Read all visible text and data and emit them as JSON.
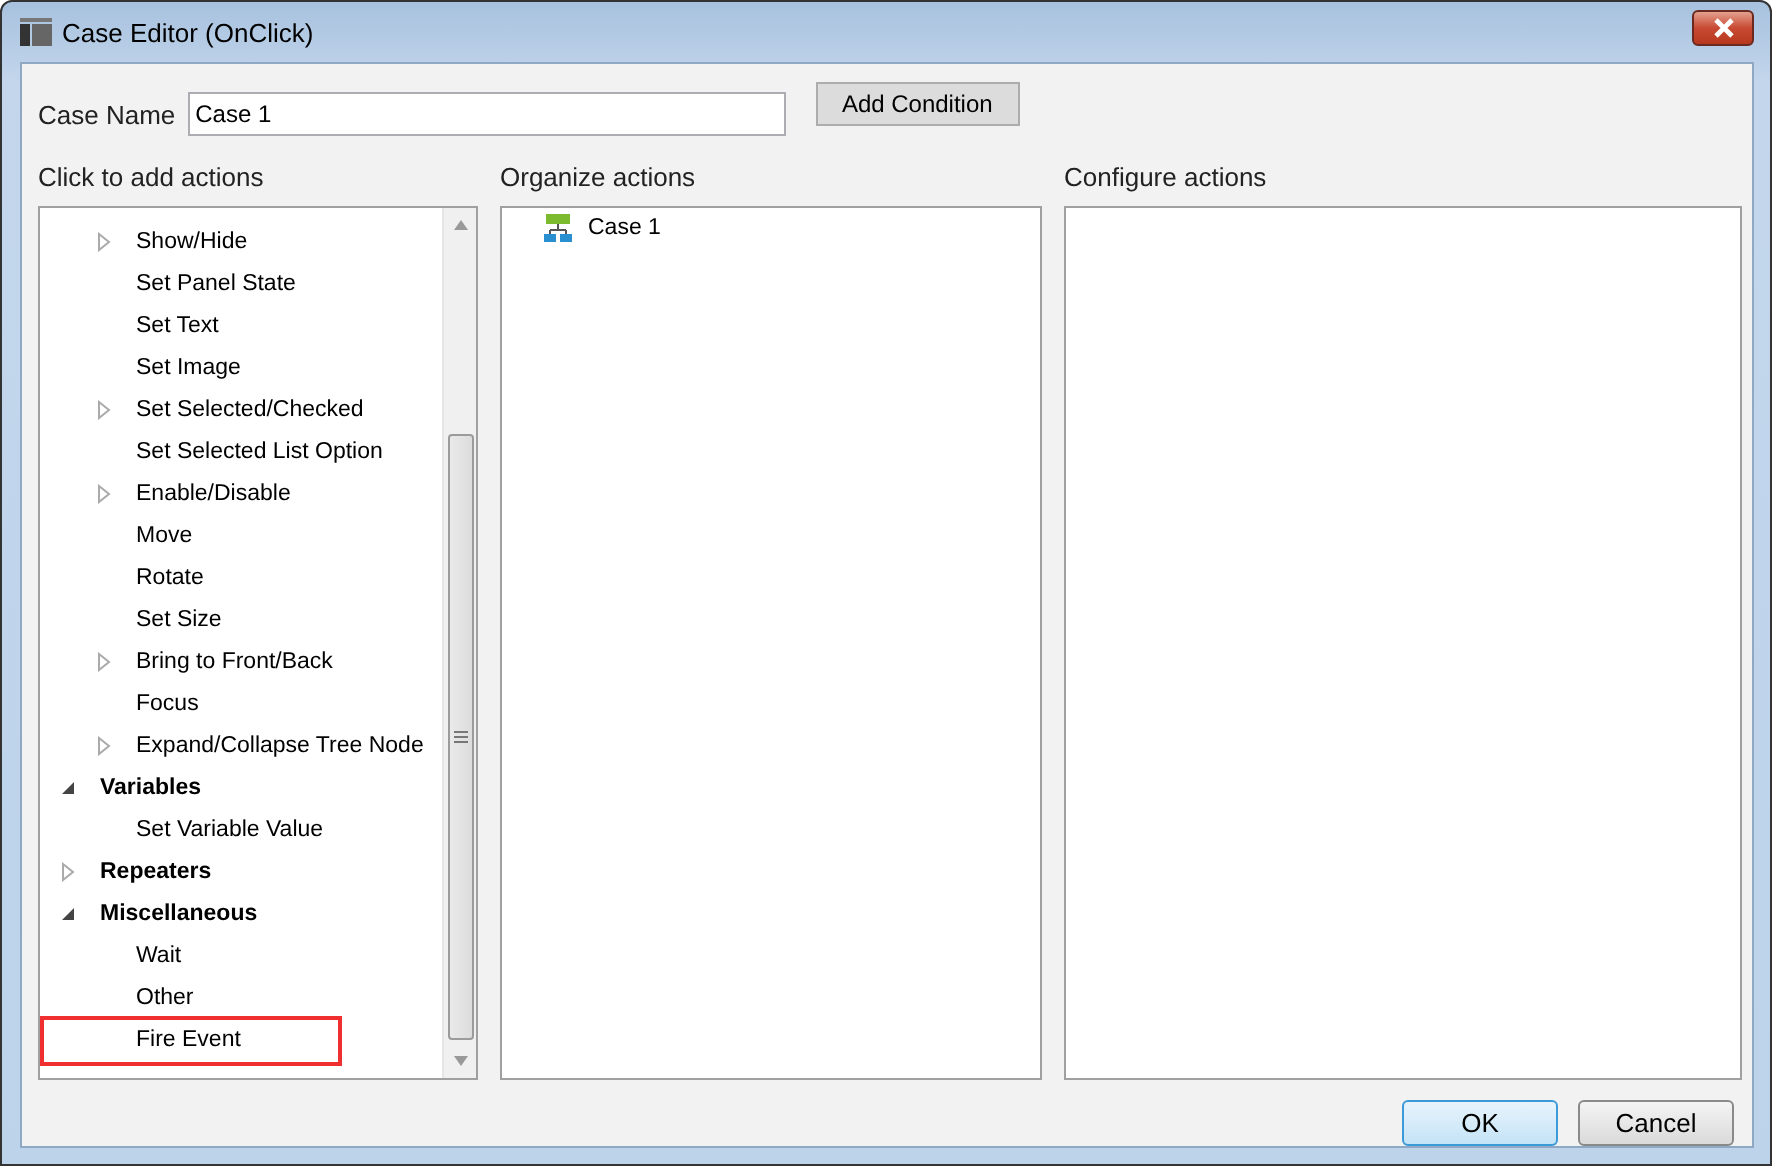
{
  "window": {
    "title": "Case Editor (OnClick)"
  },
  "case_name": {
    "label": "Case Name",
    "value": "Case 1"
  },
  "add_condition_button": "Add Condition",
  "panels": [
    {
      "title": "Click to add actions"
    },
    {
      "title": "Organize actions"
    },
    {
      "title": "Configure actions"
    }
  ],
  "actions_tree": [
    {
      "label": "Show/Hide",
      "kind": "action",
      "expanded": false,
      "highlighted": false
    },
    {
      "label": "Set Panel State",
      "kind": "action",
      "highlighted": false
    },
    {
      "label": "Set Text",
      "kind": "action",
      "highlighted": false
    },
    {
      "label": "Set Image",
      "kind": "action",
      "highlighted": false
    },
    {
      "label": "Set Selected/Checked",
      "kind": "action",
      "expanded": false,
      "highlighted": false
    },
    {
      "label": "Set Selected List Option",
      "kind": "action",
      "highlighted": false
    },
    {
      "label": "Enable/Disable",
      "kind": "action",
      "expanded": false,
      "highlighted": false
    },
    {
      "label": "Move",
      "kind": "action",
      "highlighted": false
    },
    {
      "label": "Rotate",
      "kind": "action",
      "highlighted": false
    },
    {
      "label": "Set Size",
      "kind": "action",
      "highlighted": false
    },
    {
      "label": "Bring to Front/Back",
      "kind": "action",
      "expanded": false,
      "highlighted": false
    },
    {
      "label": "Focus",
      "kind": "action",
      "highlighted": false
    },
    {
      "label": "Expand/Collapse Tree Node",
      "kind": "action",
      "expanded": false,
      "highlighted": false
    },
    {
      "label": "Variables",
      "kind": "group",
      "expanded": true,
      "highlighted": false,
      "children": [
        {
          "label": "Set Variable Value",
          "kind": "action",
          "highlighted": false
        }
      ]
    },
    {
      "label": "Repeaters",
      "kind": "group",
      "expanded": false,
      "highlighted": false
    },
    {
      "label": "Miscellaneous",
      "kind": "group",
      "expanded": true,
      "highlighted": false,
      "children": [
        {
          "label": "Wait",
          "kind": "action",
          "highlighted": false
        },
        {
          "label": "Other",
          "kind": "action",
          "highlighted": false
        },
        {
          "label": "Fire Event",
          "kind": "action",
          "highlighted": true
        }
      ]
    }
  ],
  "organize_tree": [
    {
      "label": "Case 1"
    }
  ],
  "buttons": [
    {
      "label": "OK",
      "default": true
    },
    {
      "label": "Cancel",
      "default": false
    }
  ]
}
